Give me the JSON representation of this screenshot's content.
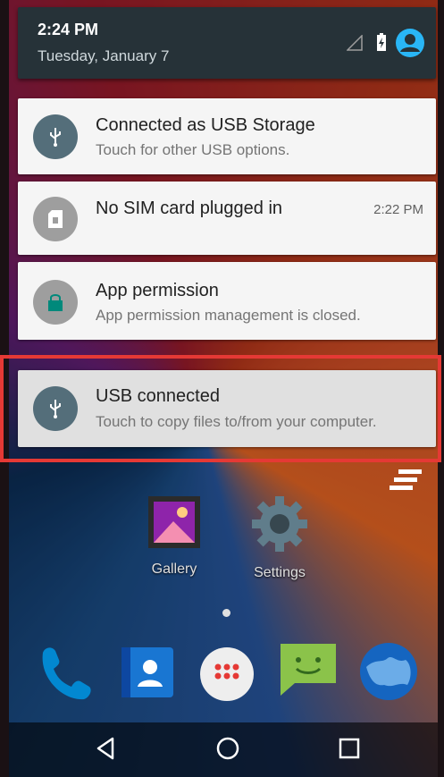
{
  "status": {
    "time": "2:24 PM",
    "date": "Tuesday, January 7"
  },
  "notifications": [
    {
      "title": "Connected as USB Storage",
      "subtitle": "Touch for other USB options.",
      "icon": "usb-icon",
      "icon_bg": "#546e7a"
    },
    {
      "title": "No SIM card plugged in",
      "time": "2:22 PM",
      "icon": "sim-card-icon",
      "icon_bg": "#9e9e9e"
    },
    {
      "title": "App permission",
      "subtitle": "App permission management is closed.",
      "icon": "lock-icon",
      "icon_bg": "#9e9e9e"
    },
    {
      "title": "USB connected",
      "subtitle": "Touch to copy files to/from your computer.",
      "icon": "usb-icon",
      "icon_bg": "#546e7a"
    }
  ],
  "apps": [
    {
      "label": "Gallery",
      "icon": "gallery-icon"
    },
    {
      "label": "Settings",
      "icon": "settings-icon"
    }
  ],
  "dock": [
    "phone-icon",
    "contacts-icon",
    "app-drawer-icon",
    "messaging-icon",
    "browser-icon"
  ],
  "nav": [
    "back-icon",
    "home-icon",
    "recents-icon"
  ],
  "colors": {
    "highlight": "#e53935",
    "header_bg": "#263238",
    "accent": "#29b6f6"
  }
}
